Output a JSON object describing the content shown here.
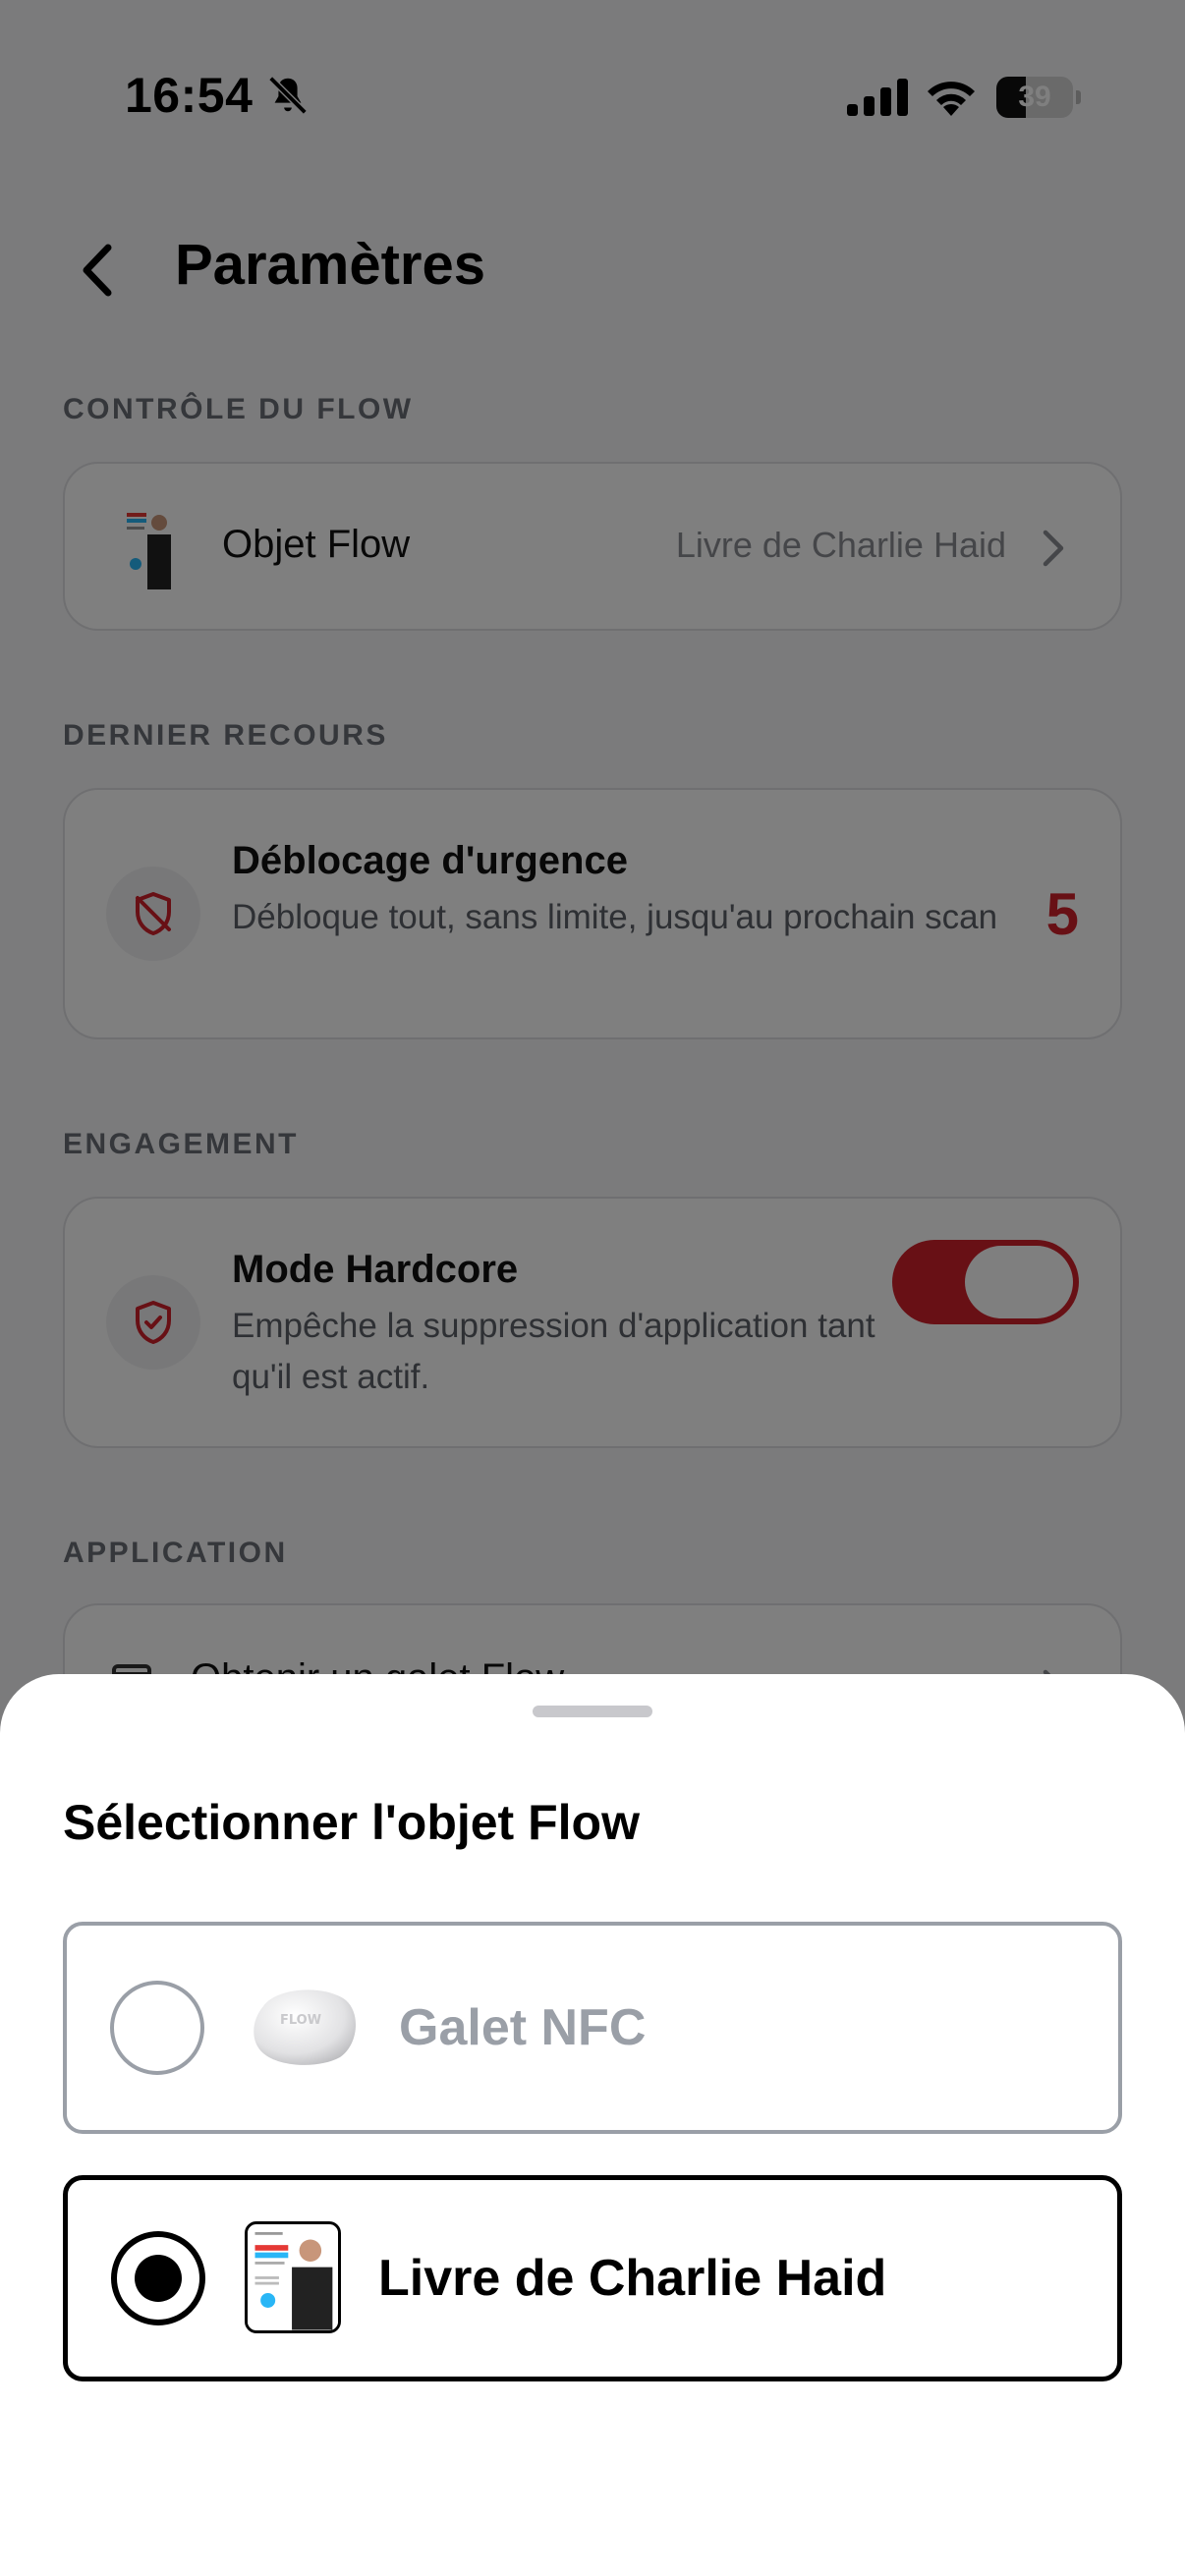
{
  "status_bar": {
    "time": "16:54",
    "battery_percent": "39",
    "battery_level": 0.39,
    "icons": [
      "bell-slash-icon",
      "signal-icon",
      "wifi-icon",
      "battery-icon"
    ]
  },
  "nav": {
    "back_icon": "chevron-left-icon",
    "title": "Paramètres"
  },
  "sections": {
    "controle": {
      "label": "CONTRÔLE DU FLOW",
      "item_title": "Objet Flow",
      "item_value": "Livre de Charlie Haid"
    },
    "recours": {
      "label": "DERNIER RECOURS",
      "item_title": "Déblocage d'urgence",
      "item_desc": "Débloque tout, sans limite, jusqu'au prochain scan",
      "item_count": "5",
      "icon": "shield-slash-icon"
    },
    "engagement": {
      "label": "ENGAGEMENT",
      "item_title": "Mode Hardcore",
      "item_desc": "Empêche la suppression d'application tant qu'il est actif.",
      "toggle_on": true,
      "icon": "shield-check-icon"
    },
    "application": {
      "label": "APPLICATION",
      "item_title": "Obtenir un galet Flow",
      "icon": "store-icon"
    }
  },
  "sheet": {
    "title": "Sélectionner l'objet Flow",
    "options": [
      {
        "label": "Galet NFC",
        "selected": false,
        "icon": "pebble-icon"
      },
      {
        "label": "Livre de Charlie Haid",
        "selected": true,
        "icon": "book-cover-icon"
      }
    ]
  },
  "colors": {
    "accent_red": "#d0202a",
    "muted_text": "#8a8d93",
    "section_label": "#6b6f76",
    "overlay": "rgba(0,0,0,0.5)"
  }
}
